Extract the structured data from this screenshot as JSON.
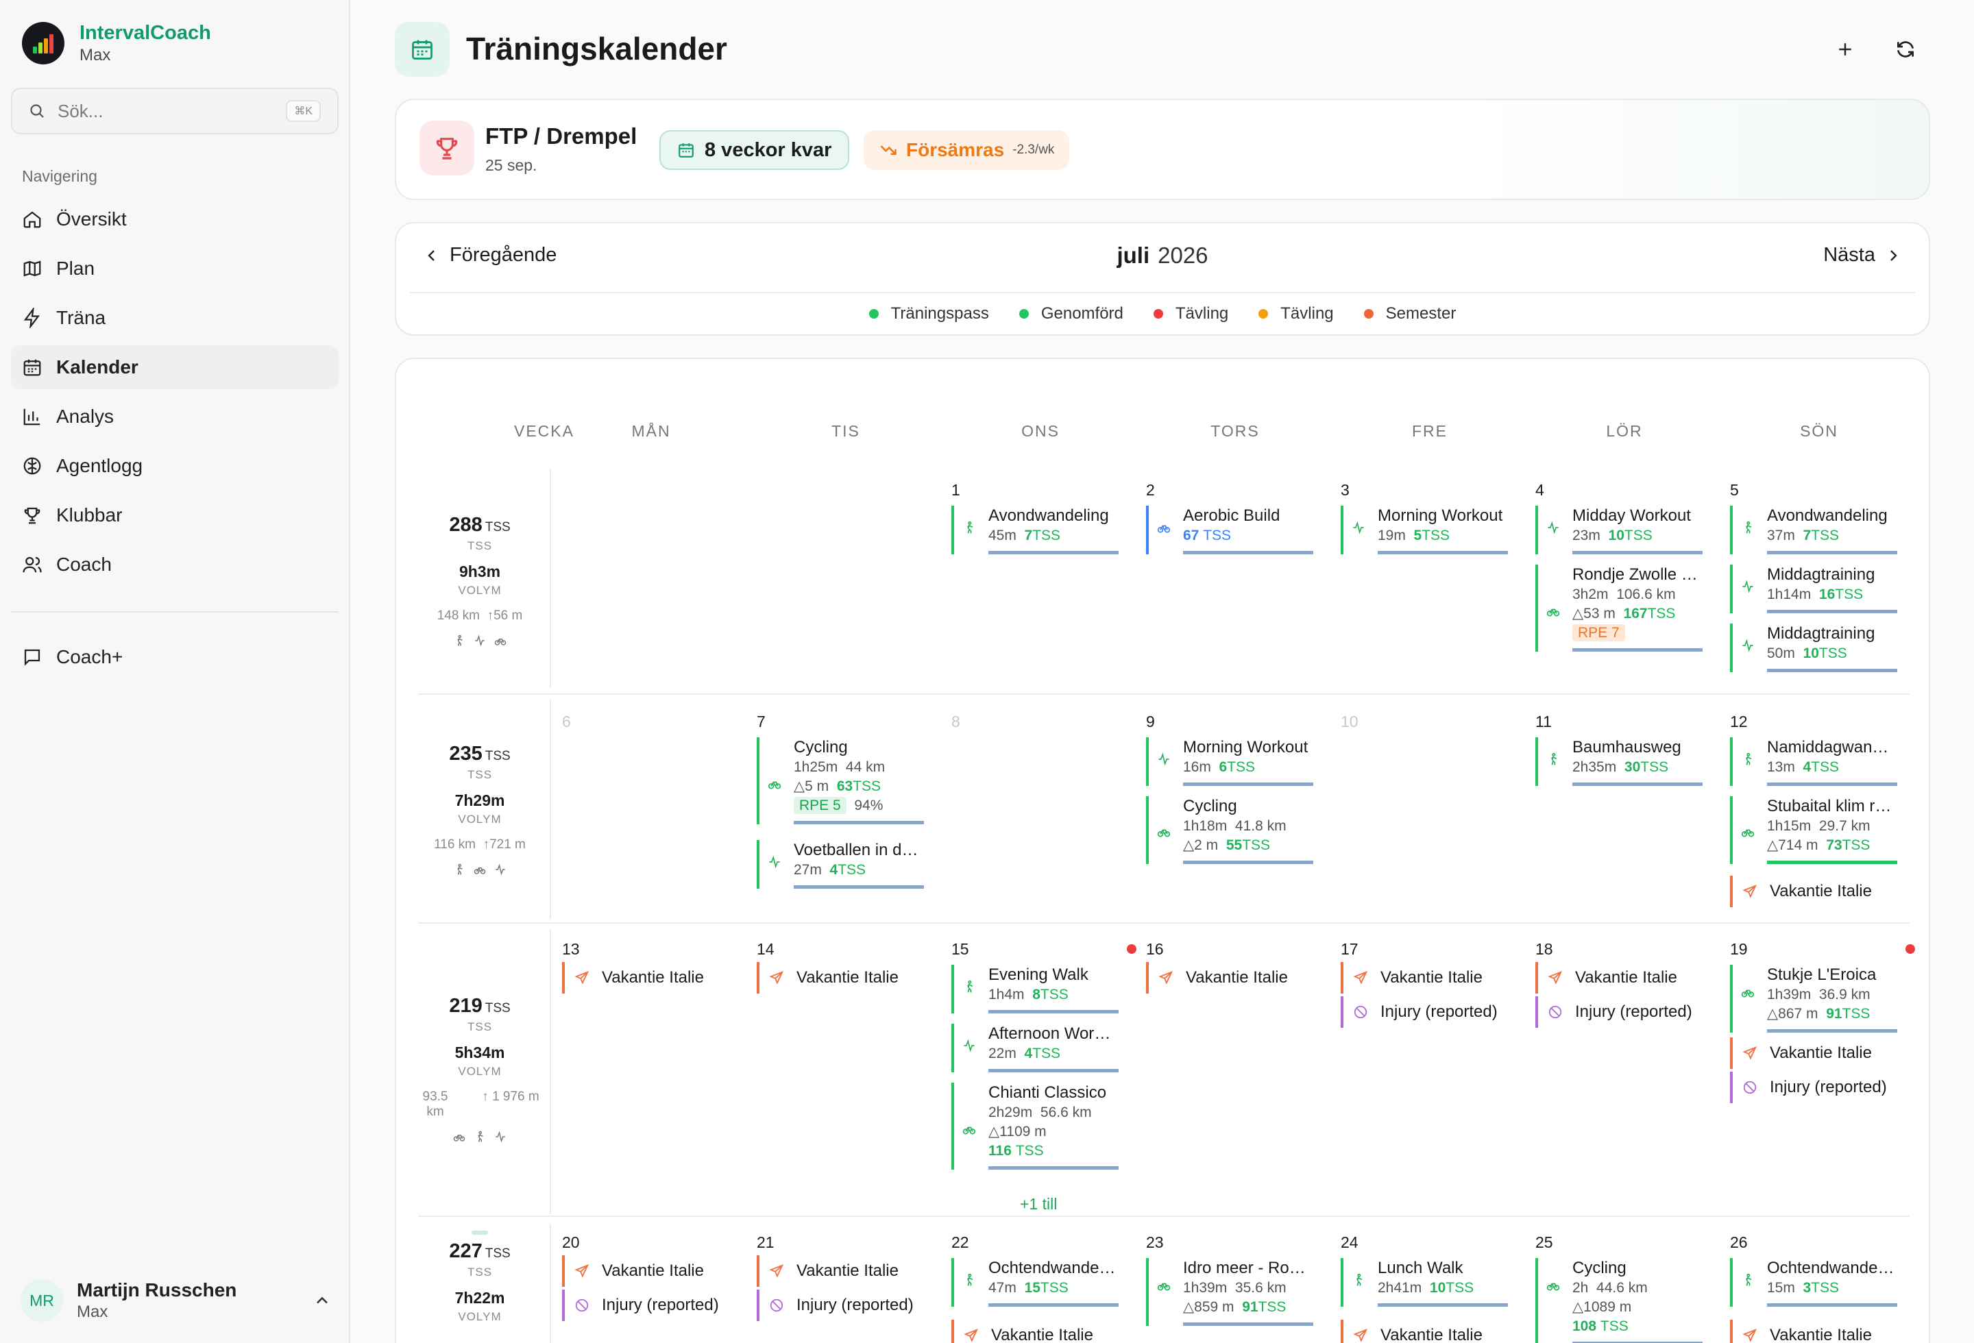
{
  "app": {
    "name": "IntervalCoach",
    "user_short": "Max"
  },
  "search": {
    "placeholder": "Sök...",
    "shortcut": "⌘K"
  },
  "nav": {
    "title": "Navigering",
    "items": [
      {
        "label": "Översikt",
        "icon": "home-icon"
      },
      {
        "label": "Plan",
        "icon": "map-icon"
      },
      {
        "label": "Träna",
        "icon": "bolt-icon"
      },
      {
        "label": "Kalender",
        "icon": "calendar-icon",
        "active": true
      },
      {
        "label": "Analys",
        "icon": "bar-chart-icon"
      },
      {
        "label": "Agentlogg",
        "icon": "brain-icon"
      },
      {
        "label": "Klubbar",
        "icon": "trophy-icon"
      },
      {
        "label": "Coach",
        "icon": "users-icon"
      }
    ],
    "secondary": [
      {
        "label": "Coach+",
        "icon": "chat-icon"
      }
    ]
  },
  "user": {
    "initials": "MR",
    "name": "Martijn Russchen",
    "sub": "Max"
  },
  "page": {
    "title": "Träningskalender"
  },
  "goal": {
    "title": "FTP / Drempel",
    "date": "25 sep.",
    "weeks_left": "8 veckor kvar",
    "trend_label": "Försämras",
    "trend_rate": "-2.3/wk"
  },
  "month": {
    "prev": "Föregående",
    "next": "Nästa",
    "month": "juli",
    "year": "2026"
  },
  "legend": [
    {
      "label": "Träningspass",
      "color": "#22c55e"
    },
    {
      "label": "Genomförd",
      "color": "#22c55e"
    },
    {
      "label": "Tävling",
      "color": "#ef3b3b"
    },
    {
      "label": "Tävling",
      "color": "#f59e0b"
    },
    {
      "label": "Semester",
      "color": "#f2643a"
    }
  ],
  "columns": [
    "VECKA",
    "MÅN",
    "TIS",
    "ONS",
    "TORS",
    "FRE",
    "LÖR",
    "SÖN"
  ],
  "weeks": [
    {
      "tss": "288",
      "tss_unit": "TSS",
      "tss_label": "TSS",
      "volume": "9h3m",
      "volume_label": "VOLYM",
      "km": "148 km",
      "elev": "↑56 m"
    },
    {
      "tss": "235",
      "tss_unit": "TSS",
      "tss_label": "TSS",
      "volume": "7h29m",
      "volume_label": "VOLYM",
      "km": "116 km",
      "elev": "↑721 m"
    },
    {
      "tss": "219",
      "tss_unit": "TSS",
      "tss_label": "TSS",
      "volume": "5h34m",
      "volume_label": "VOLYM",
      "km": "93.5 km",
      "elev": "1 976 m"
    },
    {
      "tss": "227",
      "tss_unit": "TSS",
      "tss_label": "TSS",
      "volume": "7h22m",
      "volume_label": "VOLYM"
    }
  ],
  "days": {
    "w1": [
      "1",
      "2",
      "3",
      "4",
      "5"
    ],
    "w2": [
      "6",
      "7",
      "8",
      "9",
      "10",
      "11",
      "12"
    ],
    "w3": [
      "13",
      "14",
      "15",
      "16",
      "17",
      "18",
      "19"
    ],
    "w4": [
      "20",
      "21",
      "22",
      "23",
      "24",
      "25",
      "26"
    ]
  },
  "events": {
    "d1": {
      "title": "Avondwandeling",
      "dur": "45m",
      "tss": "7",
      "tss_unit": "TSS"
    },
    "d2": {
      "title": "Aerobic Build",
      "tss": "67",
      "tss_unit": "TSS"
    },
    "d3": {
      "title": "Morning Workout",
      "dur": "19m",
      "tss": "5",
      "tss_unit": "TSS"
    },
    "d4a": {
      "title": "Midday Workout",
      "dur": "23m",
      "tss": "10",
      "tss_unit": "TSS"
    },
    "d4b": {
      "title": "Rondje Zwolle en omgeving",
      "dur": "3h2m",
      "dist": "106.6 km",
      "elev": "53 m",
      "tss": "167",
      "tss_unit": "TSS",
      "rpe": "RPE 7"
    },
    "d5a": {
      "title": "Avondwandeling",
      "dur": "37m",
      "tss": "7",
      "tss_unit": "TSS"
    },
    "d5b": {
      "title": "Middagtraining",
      "dur": "1h14m",
      "tss": "16",
      "tss_unit": "TSS"
    },
    "d5c": {
      "title": "Middagtraining",
      "dur": "50m",
      "tss": "10",
      "tss_unit": "TSS"
    },
    "d7a": {
      "title": "Cycling",
      "dur": "1h25m",
      "dist": "44 km",
      "elev": "5 m",
      "tss": "63",
      "tss_unit": "TSS",
      "rpe": "RPE 5",
      "pct": "94%"
    },
    "d7b": {
      "title": "Voetballen in de tuin",
      "dur": "27m",
      "tss": "4",
      "tss_unit": "TSS"
    },
    "d9a": {
      "title": "Morning Workout",
      "dur": "16m",
      "tss": "6",
      "tss_unit": "TSS"
    },
    "d9b": {
      "title": "Cycling",
      "dur": "1h18m",
      "dist": "41.8 km",
      "elev": "2 m",
      "tss": "55",
      "tss_unit": "TSS"
    },
    "d11": {
      "title": "Baumhausweg",
      "dur": "2h35m",
      "tss": "30",
      "tss_unit": "TSS"
    },
    "d12a": {
      "title": "Namiddagwandeling",
      "dur": "13m",
      "tss": "4",
      "tss_unit": "TSS"
    },
    "d12b": {
      "title": "Stubaital klim rondje",
      "dur": "1h15m",
      "dist": "29.7 km",
      "elev": "714 m",
      "tss": "73",
      "tss_unit": "TSS"
    },
    "d15a": {
      "title": "Evening Walk",
      "dur": "1h4m",
      "tss": "8",
      "tss_unit": "TSS"
    },
    "d15b": {
      "title": "Afternoon Workout",
      "dur": "22m",
      "tss": "4",
      "tss_unit": "TSS"
    },
    "d15c": {
      "title": "Chianti Classico",
      "dur": "2h29m",
      "dist": "56.6 km",
      "elev": "1109 m",
      "tss": "116",
      "tss_unit": "TSS"
    },
    "d15_more": "+1 till",
    "d19a": {
      "title": "Stukje L'Eroica",
      "dur": "1h39m",
      "dist": "36.9 km",
      "elev": "867 m",
      "tss": "91",
      "tss_unit": "TSS"
    },
    "d22a": {
      "title": "Ochtendwandeling",
      "dur": "47m",
      "tss": "15",
      "tss_unit": "TSS"
    },
    "d23a": {
      "title": "Idro meer - Rondje",
      "dur": "1h39m",
      "dist": "35.6 km",
      "elev": "859 m",
      "tss": "91",
      "tss_unit": "TSS"
    },
    "d24a": {
      "title": "Lunch Walk",
      "dur": "2h41m",
      "tss": "10",
      "tss_unit": "TSS"
    },
    "d25a": {
      "title": "Cycling",
      "dur": "2h",
      "dist": "44.6 km",
      "elev": "1089 m",
      "tss": "108",
      "tss_unit": "TSS"
    },
    "d26a": {
      "title": "Ochtendwandeling",
      "dur": "15m",
      "tss": "3",
      "tss_unit": "TSS"
    }
  },
  "labels": {
    "vacation": "Vakantie Italie",
    "injury": "Injury (reported)"
  },
  "colors": {
    "accent": "#109a6e",
    "completed": "#22c55e",
    "race": "#ef3b3b",
    "vacation": "#f07043",
    "injury": "#b36bd8"
  }
}
